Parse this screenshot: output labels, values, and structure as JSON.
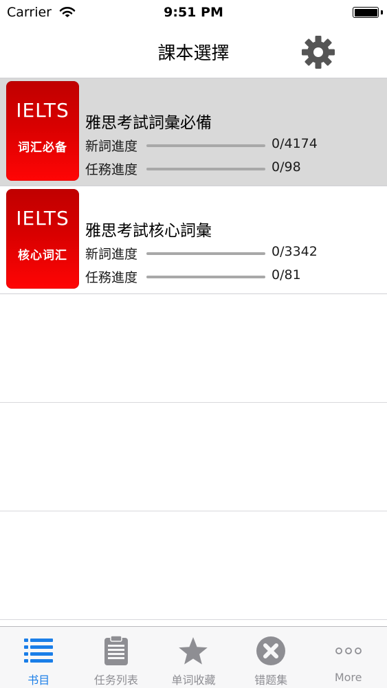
{
  "status_bar": {
    "carrier": "Carrier",
    "time": "9:51 PM"
  },
  "nav": {
    "title": "課本選擇",
    "settings_icon": "gear-icon"
  },
  "colors": {
    "accent": "#1a7ee8",
    "cover_red": "#d80000",
    "tab_inactive": "#8e8e93"
  },
  "books": [
    {
      "cover_title": "IELTS",
      "cover_subtitle": "词汇必备",
      "title": "雅思考試詞彙必備",
      "selected": true,
      "new_words": {
        "label": "新詞進度",
        "count": "0/4174",
        "progress": 0
      },
      "tasks": {
        "label": "任務進度",
        "count": "0/98",
        "progress": 0
      }
    },
    {
      "cover_title": "IELTS",
      "cover_subtitle": "核心词汇",
      "title": "雅思考試核心詞彙",
      "selected": false,
      "new_words": {
        "label": "新詞進度",
        "count": "0/3342",
        "progress": 0
      },
      "tasks": {
        "label": "任務進度",
        "count": "0/81",
        "progress": 0
      }
    }
  ],
  "tabs": [
    {
      "label": "书目",
      "icon": "list-icon",
      "active": true
    },
    {
      "label": "任务列表",
      "icon": "clipboard-icon",
      "active": false
    },
    {
      "label": "单词收藏",
      "icon": "star-icon",
      "active": false
    },
    {
      "label": "错题集",
      "icon": "close-circle-icon",
      "active": false
    },
    {
      "label": "More",
      "icon": "more-icon",
      "active": false
    }
  ]
}
